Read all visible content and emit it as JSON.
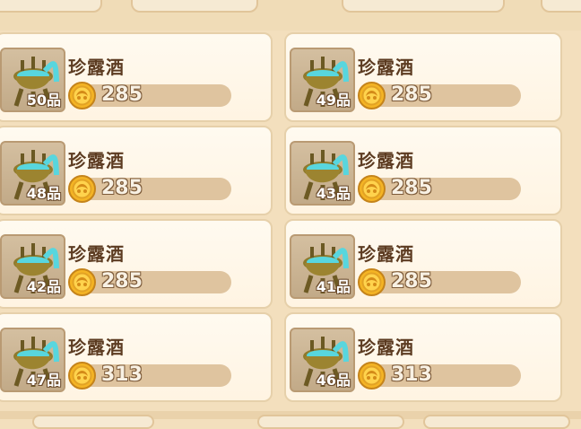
{
  "shop": {
    "items": [
      {
        "name": "珍露酒",
        "quality": "50品",
        "price": "285"
      },
      {
        "name": "珍露酒",
        "quality": "49品",
        "price": "285"
      },
      {
        "name": "珍露酒",
        "quality": "48品",
        "price": "285"
      },
      {
        "name": "珍露酒",
        "quality": "43品",
        "price": "285"
      },
      {
        "name": "珍露酒",
        "quality": "42品",
        "price": "285"
      },
      {
        "name": "珍露酒",
        "quality": "41品",
        "price": "285"
      },
      {
        "name": "珍露酒",
        "quality": "47品",
        "price": "313"
      },
      {
        "name": "珍露酒",
        "quality": "46品",
        "price": "313"
      }
    ]
  }
}
